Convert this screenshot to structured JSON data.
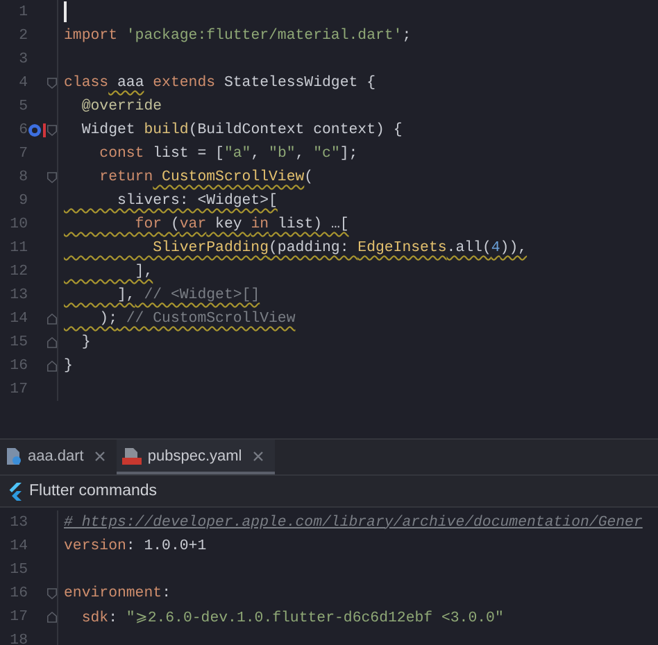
{
  "editor": {
    "lines": [
      {
        "number": "1",
        "cursor": true
      },
      {
        "number": "2",
        "tokens": [
          {
            "text": "import",
            "kind": "keyword"
          },
          {
            "text": " 'package:flutter/material.dart'",
            "kind": "string"
          },
          {
            "text": ";",
            "kind": "plain"
          }
        ]
      },
      {
        "number": "3"
      },
      {
        "number": "4",
        "fold_start": true,
        "tokens": [
          {
            "text": "class",
            "kind": "keyword"
          },
          {
            "text": " aaa",
            "kind": "plain",
            "underlined": true
          },
          {
            "text": " extends",
            "kind": "keyword"
          },
          {
            "text": " StatelessWidget {",
            "kind": "plain"
          }
        ]
      },
      {
        "number": "5",
        "tokens": [
          {
            "text": "  @override",
            "kind": "annotation"
          }
        ]
      },
      {
        "number": "6",
        "fold_start": true,
        "override_marker": true,
        "tokens": [
          {
            "text": "  Widget ",
            "kind": "plain"
          },
          {
            "text": "build",
            "kind": "function"
          },
          {
            "text": "(BuildContext context) {",
            "kind": "plain"
          }
        ]
      },
      {
        "number": "7",
        "tokens": [
          {
            "text": "    const",
            "kind": "keyword"
          },
          {
            "text": " list = [",
            "kind": "plain"
          },
          {
            "text": "\"a\"",
            "kind": "string"
          },
          {
            "text": ", ",
            "kind": "plain"
          },
          {
            "text": "\"b\"",
            "kind": "string"
          },
          {
            "text": ", ",
            "kind": "plain"
          },
          {
            "text": "\"c\"",
            "kind": "string"
          },
          {
            "text": "];",
            "kind": "plain"
          }
        ]
      },
      {
        "number": "8",
        "fold_start": true,
        "tokens": [
          {
            "text": "    return",
            "kind": "keyword"
          },
          {
            "text": " CustomScrollView",
            "kind": "class",
            "underlined": true
          },
          {
            "text": "(",
            "kind": "plain"
          }
        ]
      },
      {
        "number": "9",
        "warning": true,
        "tokens": [
          {
            "text": "      slivers: <Widget>[",
            "kind": "plain"
          }
        ]
      },
      {
        "number": "10",
        "warning": true,
        "tokens": [
          {
            "text": "        for",
            "kind": "keyword"
          },
          {
            "text": " (",
            "kind": "plain"
          },
          {
            "text": "var",
            "kind": "keyword"
          },
          {
            "text": " key ",
            "kind": "plain"
          },
          {
            "text": "in",
            "kind": "keyword"
          },
          {
            "text": " list) …[",
            "kind": "plain"
          }
        ]
      },
      {
        "number": "11",
        "warning": true,
        "tokens": [
          {
            "text": "          SliverPadding",
            "kind": "class"
          },
          {
            "text": "(padding: ",
            "kind": "plain"
          },
          {
            "text": "EdgeInsets",
            "kind": "class"
          },
          {
            "text": ".all(",
            "kind": "plain"
          },
          {
            "text": "4",
            "kind": "number"
          },
          {
            "text": ")),",
            "kind": "plain"
          }
        ]
      },
      {
        "number": "12",
        "warning": true,
        "tokens": [
          {
            "text": "        ],",
            "kind": "plain"
          }
        ]
      },
      {
        "number": "13",
        "warning": true,
        "tokens": [
          {
            "text": "      ],",
            "kind": "plain"
          },
          {
            "text": " // <Widget>[]",
            "kind": "comment"
          }
        ]
      },
      {
        "number": "14",
        "warning": true,
        "fold_end": true,
        "tokens": [
          {
            "text": "    );",
            "kind": "plain"
          },
          {
            "text": " // CustomScrollView",
            "kind": "comment"
          }
        ]
      },
      {
        "number": "15",
        "fold_end": true,
        "tokens": [
          {
            "text": "  }",
            "kind": "plain"
          }
        ]
      },
      {
        "number": "16",
        "fold_end": true,
        "tokens": [
          {
            "text": "}",
            "kind": "plain"
          }
        ]
      },
      {
        "number": "17"
      }
    ]
  },
  "tabs": [
    {
      "label": "aaa.dart",
      "kind": "dart",
      "selected": false
    },
    {
      "label": "pubspec.yaml",
      "kind": "yaml",
      "selected": true
    }
  ],
  "toolbar": {
    "label": "Flutter commands"
  },
  "yaml_editor": {
    "lines": [
      {
        "number": "13",
        "tokens": [
          {
            "text": "# https://developer.apple.com/library/archive/documentation/Gener",
            "kind": "link"
          }
        ]
      },
      {
        "number": "14",
        "tokens": [
          {
            "text": "version",
            "kind": "keyword"
          },
          {
            "text": ": 1.0.0+1",
            "kind": "plain"
          }
        ]
      },
      {
        "number": "15"
      },
      {
        "number": "16",
        "fold_start": true,
        "tokens": [
          {
            "text": "environment",
            "kind": "keyword"
          },
          {
            "text": ":",
            "kind": "plain"
          }
        ]
      },
      {
        "number": "17",
        "fold_end": true,
        "tokens": [
          {
            "text": "  sdk",
            "kind": "keyword"
          },
          {
            "text": ": ",
            "kind": "plain"
          },
          {
            "text": "\"⩾2.6.0-dev.1.0.flutter-d6c6d12ebf <3.0.0\"",
            "kind": "string"
          }
        ]
      },
      {
        "number": "18"
      }
    ]
  }
}
